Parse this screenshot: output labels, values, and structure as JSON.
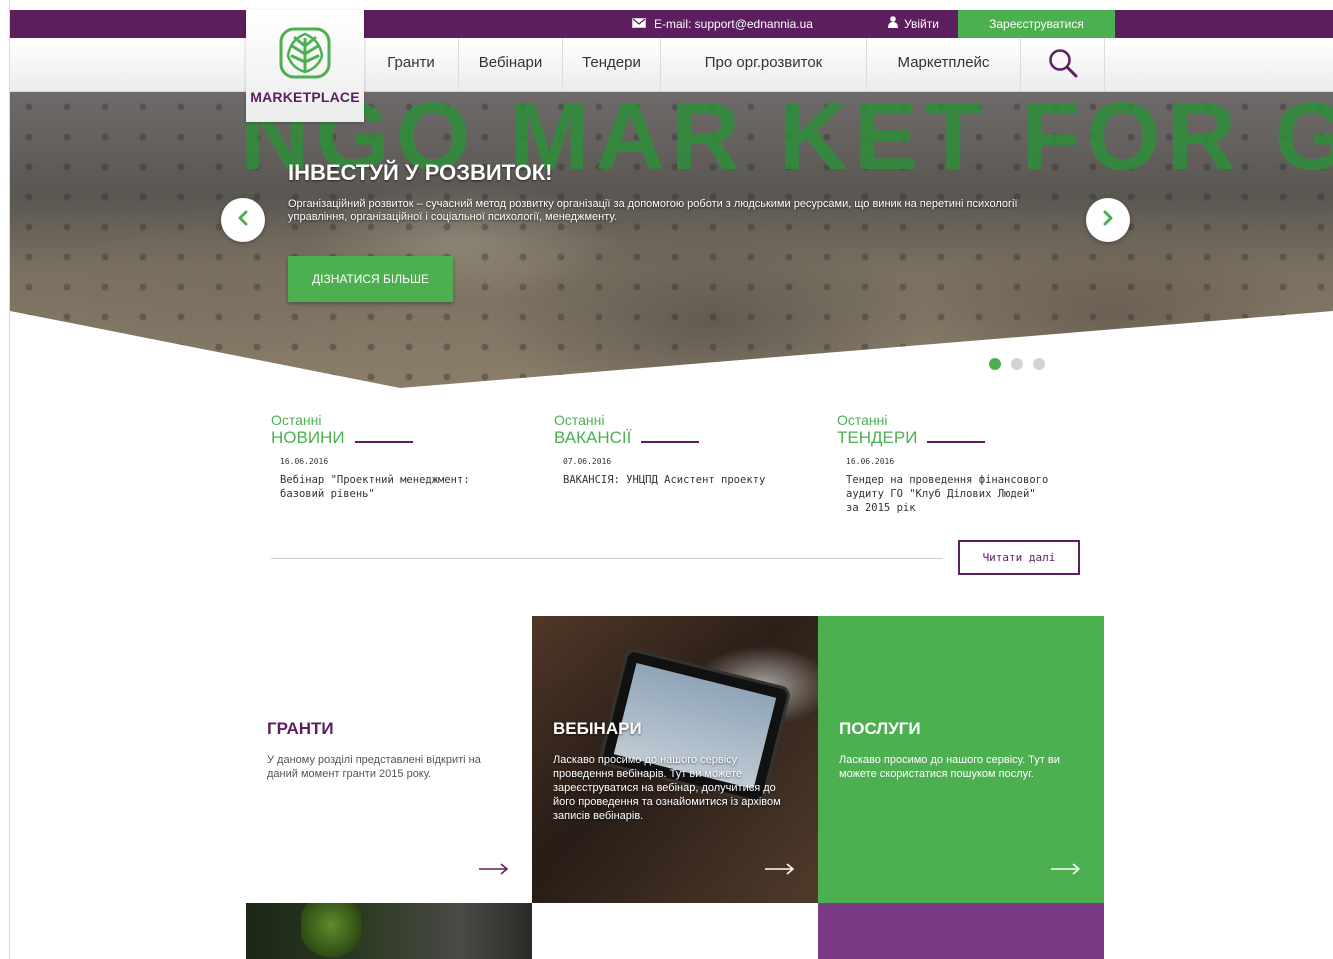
{
  "topbar": {
    "email_label": "E-mail: support@ednannia.ua",
    "login_label": "Увійти",
    "register_label": "Зареєструватися"
  },
  "logo": {
    "text": "MARKETPLACE"
  },
  "nav": {
    "items": [
      "Гранти",
      "Вебінари",
      "Тендери",
      "Про орг.розвиток",
      "Маркетплейс"
    ]
  },
  "hero": {
    "background_text": "NGO MAR KET FOR G",
    "title": "ІНВЕСТУЙ У РОЗВИТОК!",
    "description": "Організаційний розвиток – сучасний метод розвитку організації за допомогою роботи з людськими ресурсами, що виник на перетині психології управління, організаційної і соціальної психології, менеджменту.",
    "button_label": "ДІЗНАТИСЯ БІЛЬШЕ",
    "slides_total": 3,
    "active_slide": 1
  },
  "latest": [
    {
      "pre": "Останні",
      "title": "НОВИНИ",
      "date": "16.06.2016",
      "item": "Вебінар \"Проектний менеджмент: базовий рівень\""
    },
    {
      "pre": "Останні",
      "title": "ВАКАНСІЇ",
      "date": "07.06.2016",
      "item": "ВАКАНСІЯ: УНЦПД Асистент проекту"
    },
    {
      "pre": "Останні",
      "title": "ТЕНДЕРИ",
      "date": "16.06.2016",
      "item": "Тендер на проведення фінансового аудиту ГО \"Клуб Ділових Людей\" за 2015 рік"
    }
  ],
  "read_more_label": "Читати далі",
  "tiles": {
    "grants": {
      "title": "ГРАНТИ",
      "text": "У даному розділі представлені відкриті на даний момент гранти 2015 року."
    },
    "webinars": {
      "title": "ВЕБІНАРИ",
      "text": "Ласкаво просимо до нашого сервісу проведення вебінарів. Тут ви можете зареєструватися на вебінар, долучитися до його проведення та ознайомитися із архівом записів вебінарів."
    },
    "services": {
      "title": "ПОСЛУГИ",
      "text": "Ласкаво просимо до нашого сервісу. Тут ви можете скористатися пошуком послуг."
    }
  },
  "colors": {
    "purple": "#5c1e5f",
    "green": "#4cb050",
    "purple_light": "#7b3a85"
  }
}
